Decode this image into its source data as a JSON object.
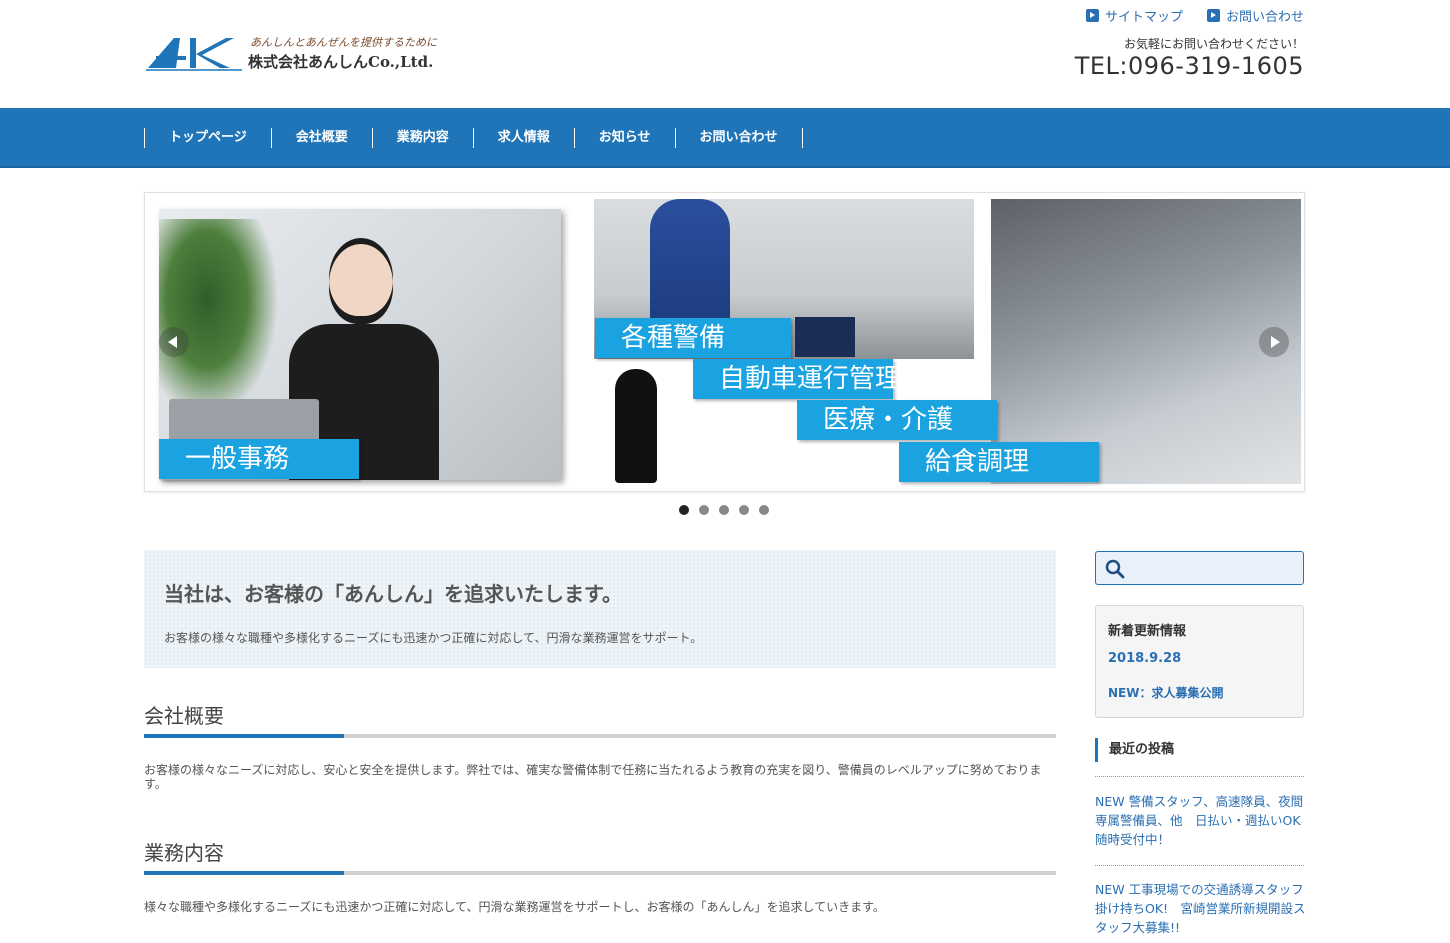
{
  "header": {
    "logo_tagline": "あんしんとあんぜんを提供するために",
    "logo_name": "株式会社あんしんCo.,Ltd.",
    "top_links": [
      "サイトマップ",
      "お問い合わせ"
    ],
    "contact_note": "お気軽にお問い合わせください！",
    "tel": "TEL:096-319-1605"
  },
  "nav": {
    "items": [
      "トップページ",
      "会社概要",
      "業務内容",
      "求人情報",
      "お知らせ",
      "お問い合わせ"
    ]
  },
  "slider": {
    "labels": [
      "一般事務",
      "各種警備",
      "自動車運行管理",
      "医療・介護",
      "給食調理"
    ],
    "slide_count": 5,
    "active_slide": 1
  },
  "intro": {
    "title": "当社は、お客様の「あんしん」を追求いたします。",
    "text": "お客様の様々な職種や多様化するニーズにも迅速かつ正確に対応して、円滑な業務運営をサポート。"
  },
  "sections": [
    {
      "heading": "会社概要",
      "text": "お客様の様々なニーズに対応し、安心と安全を提供します。弊社では、確実な警備体制で任務に当たれるよう教育の充実を図り、警備員のレベルアップに努めております。"
    },
    {
      "heading": "業務内容",
      "text": "様々な職種や多様化するニーズにも迅速かつ正確に対応して、円滑な業務運営をサポートし、お客様の「あんしん」を追求していきます。"
    }
  ],
  "sidebar": {
    "search_placeholder": "",
    "news": {
      "title": "新着更新情報",
      "date": "2018.9.28",
      "item": "NEW：求人募集公開"
    },
    "recent": {
      "title": "最近の投稿",
      "posts": [
        "NEW 警備スタッフ、高速隊員、夜間専属警備員、他　日払い・週払いOK　随時受付中！",
        "NEW 工事現場での交通誘導スタッフ 掛け持ちOK!　宮崎営業所新規開設スタッフ大募集!!"
      ]
    }
  },
  "colors": {
    "brand_blue": "#1f75b8",
    "link_blue": "#2a6fb3",
    "slide_label": "#1aa3e0"
  }
}
